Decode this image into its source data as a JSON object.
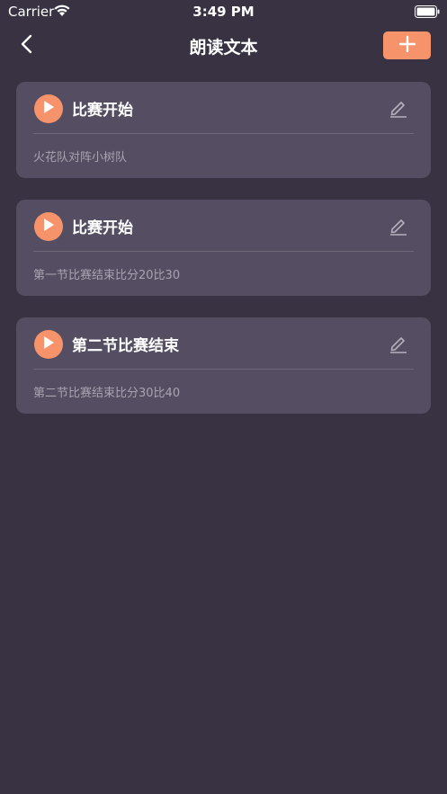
{
  "status_bar": {
    "carrier": "Carrier",
    "time": "3:49 PM",
    "wifi_icon": "wifi-icon",
    "battery_icon": "battery-icon"
  },
  "nav": {
    "title": "朗读文本",
    "back_icon": "chevron-left-icon",
    "add_icon": "plus-icon"
  },
  "colors": {
    "background": "#393243",
    "card": "#554e62",
    "accent": "#f6936b",
    "subtext": "#a8a2b1"
  },
  "items": [
    {
      "title": "比赛开始",
      "text": "火花队对阵小树队"
    },
    {
      "title": "比赛开始",
      "text": "第一节比赛结束比分20比30"
    },
    {
      "title": "第二节比赛结束",
      "text": "第二节比赛结束比分30比40"
    }
  ]
}
